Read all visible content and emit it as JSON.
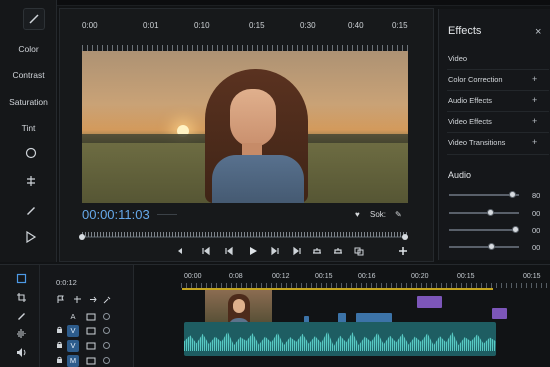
{
  "viewer": {
    "ruler_ticks": [
      "0:00",
      "0:01",
      "0:10",
      "0:15",
      "0:30",
      "0:40",
      "0:15"
    ],
    "timecode": "00:00:11:03",
    "right_label": "Sok:"
  },
  "left_panel": {
    "labels": [
      "Color",
      "Contrast",
      "Saturation",
      "Tint"
    ],
    "icons": [
      "brush-icon",
      "circle-icon",
      "crop-move-icon",
      "pen-icon",
      "play-outline-icon"
    ]
  },
  "effects": {
    "title": "Effects",
    "close": "×",
    "items": [
      {
        "label": "Video",
        "plus": ""
      },
      {
        "label": "Color Correction",
        "plus": "+"
      },
      {
        "label": "Audio Effects",
        "plus": "+"
      },
      {
        "label": "Video Effects",
        "plus": "+"
      },
      {
        "label": "Video Transitions",
        "plus": "+"
      }
    ],
    "audio_title": "Audio",
    "audio_sliders": [
      {
        "value": "80",
        "level_pct": 95
      },
      {
        "value": "00",
        "level_pct": 60
      },
      {
        "value": "00",
        "level_pct": 100
      },
      {
        "value": "00",
        "level_pct": 62
      }
    ]
  },
  "timeline": {
    "current_time": "0:0:12",
    "ruler_ticks": [
      "00:00",
      "0:08",
      "00:12",
      "00:15",
      "00:16",
      "00:20",
      "00:15",
      "00:15"
    ],
    "tracks": [
      {
        "chip": "A",
        "type": "plain"
      },
      {
        "chip": "V",
        "type": "video"
      },
      {
        "chip": "V",
        "type": "video"
      },
      {
        "chip": "M",
        "type": "video"
      }
    ]
  },
  "colors": {
    "accent_blue": "#66a9ea",
    "playhead_gold": "#c3a41f",
    "clip_blue": "#3c73a8",
    "clip_purple": "#7c56b9",
    "waveform_teal": "#1e5d62"
  }
}
